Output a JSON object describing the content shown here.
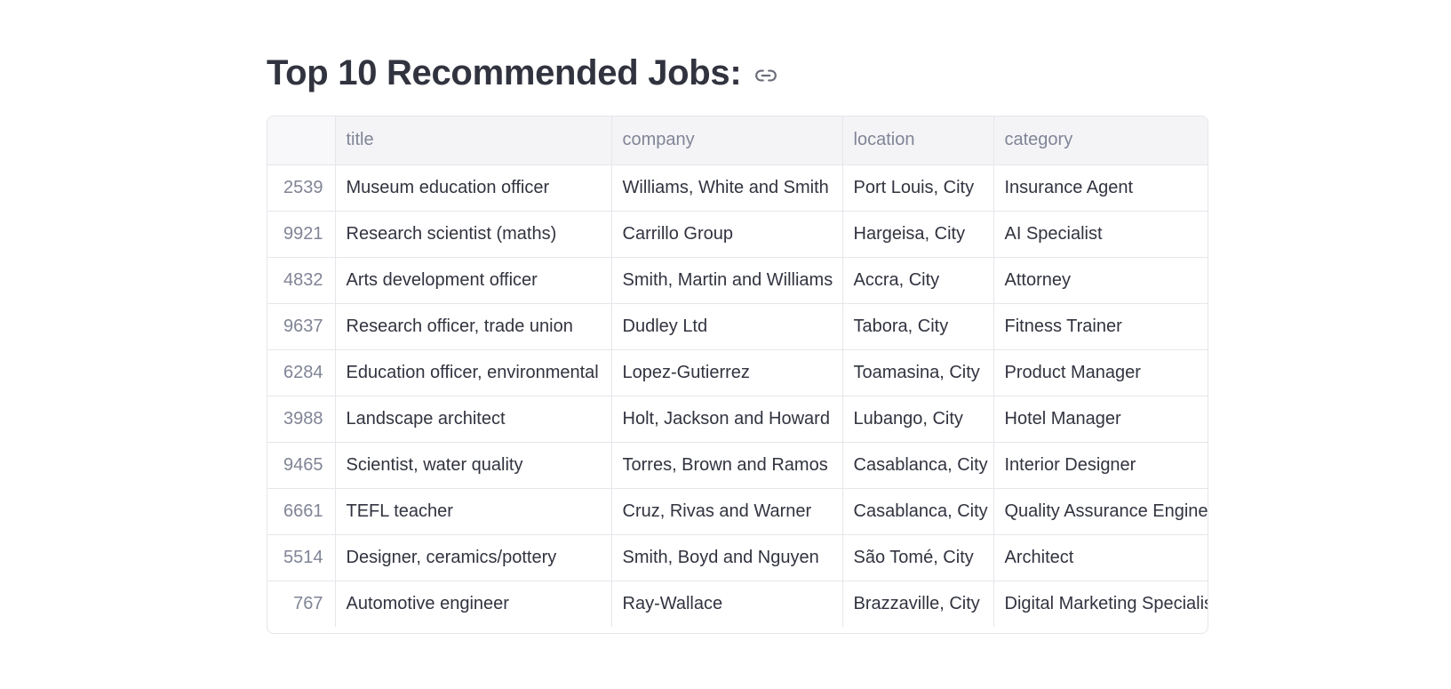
{
  "heading": {
    "title": "Top 10 Recommended Jobs:",
    "link_icon": "link-icon"
  },
  "table": {
    "columns": [
      "",
      "title",
      "company",
      "location",
      "category"
    ],
    "rows": [
      {
        "index": "2539",
        "title": "Museum education officer",
        "company": "Williams, White and Smith",
        "location": "Port Louis, City",
        "category": "Insurance Agent"
      },
      {
        "index": "9921",
        "title": "Research scientist (maths)",
        "company": "Carrillo Group",
        "location": "Hargeisa, City",
        "category": "AI Specialist"
      },
      {
        "index": "4832",
        "title": "Arts development officer",
        "company": "Smith, Martin and Williams",
        "location": "Accra, City",
        "category": "Attorney"
      },
      {
        "index": "9637",
        "title": "Research officer, trade union",
        "company": "Dudley Ltd",
        "location": "Tabora, City",
        "category": "Fitness Trainer"
      },
      {
        "index": "6284",
        "title": "Education officer, environmental",
        "company": "Lopez-Gutierrez",
        "location": "Toamasina, City",
        "category": "Product Manager"
      },
      {
        "index": "3988",
        "title": "Landscape architect",
        "company": "Holt, Jackson and Howard",
        "location": "Lubango, City",
        "category": "Hotel Manager"
      },
      {
        "index": "9465",
        "title": "Scientist, water quality",
        "company": "Torres, Brown and Ramos",
        "location": "Casablanca, City",
        "category": "Interior Designer"
      },
      {
        "index": "6661",
        "title": "TEFL teacher",
        "company": "Cruz, Rivas and Warner",
        "location": "Casablanca, City",
        "category": "Quality Assurance Engineer"
      },
      {
        "index": "5514",
        "title": "Designer, ceramics/pottery",
        "company": "Smith, Boyd and Nguyen",
        "location": "São Tomé, City",
        "category": "Architect"
      },
      {
        "index": "767",
        "title": "Automotive engineer",
        "company": "Ray-Wallace",
        "location": "Brazzaville, City",
        "category": "Digital Marketing Specialist"
      }
    ]
  }
}
